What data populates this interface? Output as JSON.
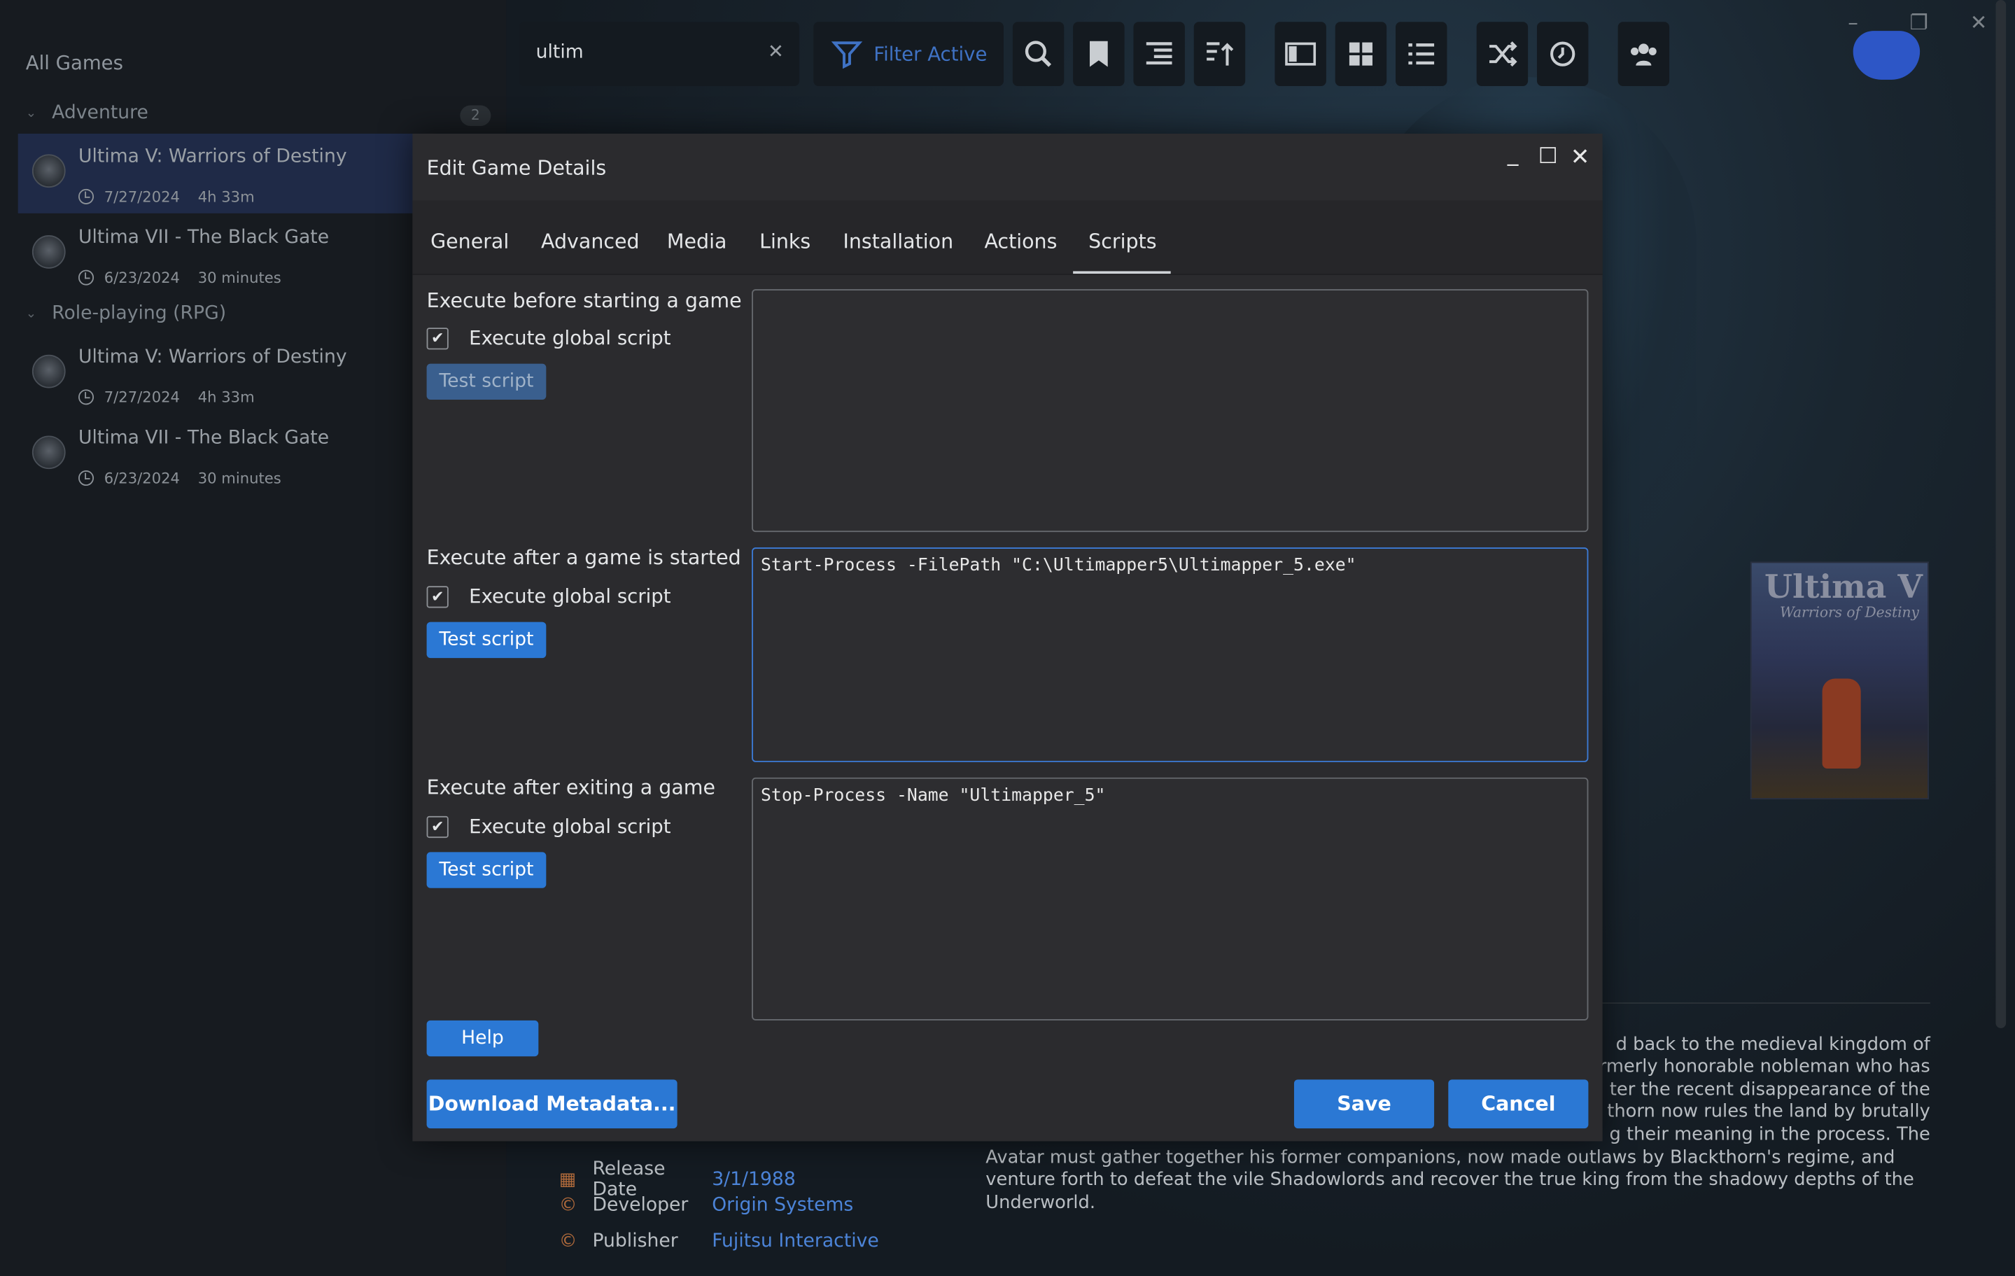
{
  "sidebar": {
    "title": "All Games",
    "groups": [
      {
        "name": "Adventure",
        "count": "2"
      },
      {
        "name": "Role-playing (RPG)"
      }
    ],
    "items": [
      {
        "name": "Ultima V: Warriors of Destiny",
        "date": "7/27/2024",
        "playtime": "4h 33m"
      },
      {
        "name": "Ultima VII - The Black Gate",
        "date": "6/23/2024",
        "playtime": "30 minutes"
      },
      {
        "name": "Ultima V: Warriors of Destiny",
        "date": "7/27/2024",
        "playtime": "4h 33m"
      },
      {
        "name": "Ultima VII - The Black Gate",
        "date": "6/23/2024",
        "playtime": "30 minutes"
      }
    ]
  },
  "toolbar": {
    "search_value": "ultim",
    "clear_glyph": "✕",
    "filter_label": "Filter Active"
  },
  "cover": {
    "title": "Ultima V",
    "subtitle": "Warriors of Destiny"
  },
  "description": {
    "lines": [
      "d back to the medieval kingdom  of",
      "rmerly honorable nobleman who  has",
      "ter the recent disappearance of  the",
      "thorn now rules the land by  brutally",
      "g their meaning in the process.  The",
      "Avatar must gather together his former companions, now made outlaws by Blackthorn's regime,  and",
      "venture forth to defeat the vile Shadowlords and recover the true king from the shadowy depths of  the",
      "Underworld."
    ]
  },
  "details": [
    {
      "label": "Release Date",
      "value": "3/1/1988"
    },
    {
      "label": "Developer",
      "value": "Origin Systems"
    },
    {
      "label": "Publisher",
      "value": "Fujitsu Interactive"
    }
  ],
  "dialog": {
    "title": "Edit Game Details",
    "tabs": [
      "General",
      "Advanced",
      "Media",
      "Links",
      "Installation",
      "Actions",
      "Scripts"
    ],
    "active_tab": "Scripts",
    "sections": [
      {
        "title": "Execute before starting a game",
        "checkbox_label": "Execute global script",
        "checked": true,
        "test_label": "Test script",
        "test_enabled": false,
        "script": ""
      },
      {
        "title": "Execute after a game is started",
        "checkbox_label": "Execute global script",
        "checked": true,
        "test_label": "Test script",
        "test_enabled": true,
        "script": "Start-Process -FilePath \"C:\\Ultimapper5\\Ultimapper_5.exe\""
      },
      {
        "title": "Execute after exiting a game",
        "checkbox_label": "Execute global script",
        "checked": true,
        "test_label": "Test script",
        "test_enabled": true,
        "script": "Stop-Process -Name \"Ultimapper_5\""
      }
    ],
    "help_label": "Help",
    "download_label": "Download Metadata...",
    "save_label": "Save",
    "cancel_label": "Cancel",
    "check_glyph": "✔"
  },
  "colors": {
    "accent": "#2b78d4",
    "dialog_bg": "#2b2b2e",
    "link": "#4c84d8"
  }
}
